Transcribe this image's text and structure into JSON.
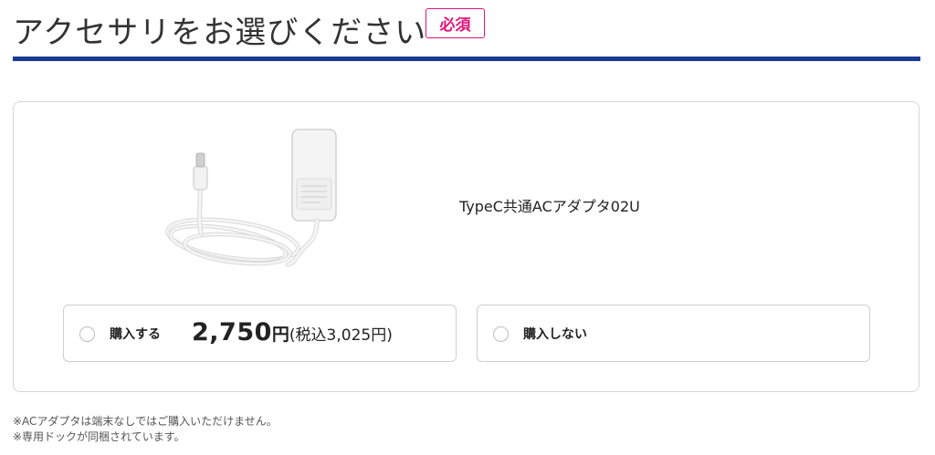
{
  "header": {
    "title": "アクセサリをお選びください",
    "required_badge": "必須",
    "accent_color": "#1b3a93",
    "badge_color": "#e0167c"
  },
  "product": {
    "name": "TypeC共通ACアダプタ02U",
    "image_icon": "ac-adapter-image"
  },
  "options": {
    "buy": {
      "label": "購入する",
      "selected": false,
      "price_main": "2,750",
      "price_yen": "円",
      "price_tax": "(税込3,025円)"
    },
    "no_buy": {
      "label": "購入しない",
      "selected": false
    }
  },
  "notes": [
    "※ACアダプタは端末なしではご購入いただけません。",
    "※専用ドックが同梱されています。"
  ]
}
